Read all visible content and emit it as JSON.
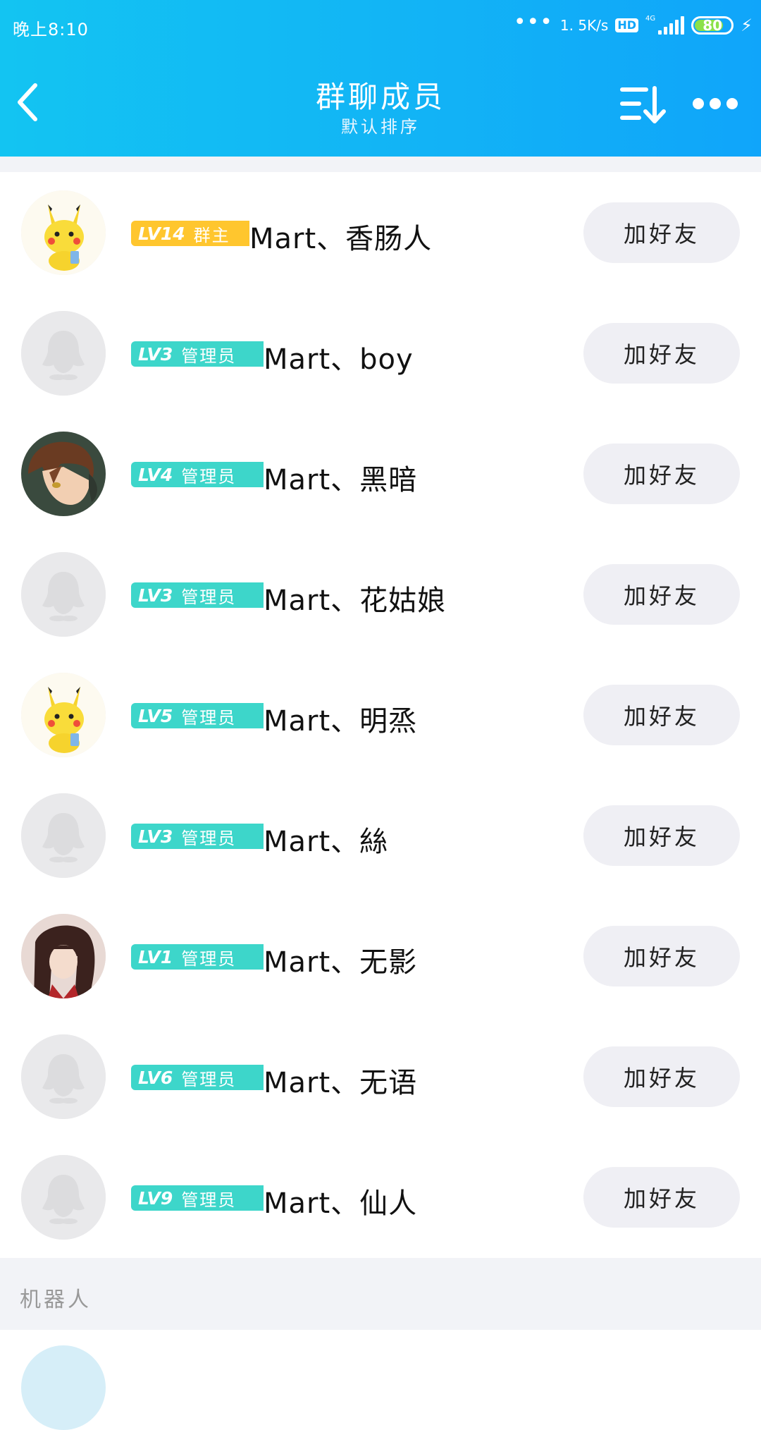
{
  "status_bar": {
    "time": "晚上8:10",
    "net_speed": "1. 5K/s",
    "hd": "HD",
    "net_type": "4G",
    "battery": "80",
    "battery_level_percent": 80
  },
  "nav": {
    "title": "群聊成员",
    "subtitle": "默认排序"
  },
  "members": [
    {
      "level": "LV14",
      "role": "群主",
      "name": "Mart、香肠人",
      "add_label": "加好友",
      "avatar": "pikachu-avatar"
    },
    {
      "level": "LV3",
      "role": "管理员",
      "name": "Mart、boy",
      "add_label": "加好友",
      "avatar": "default-penguin-avatar"
    },
    {
      "level": "LV4",
      "role": "管理员",
      "name": "Mart、黑暗",
      "add_label": "加好友",
      "avatar": "anime-boy-avatar"
    },
    {
      "level": "LV3",
      "role": "管理员",
      "name": "Mart、花姑娘",
      "add_label": "加好友",
      "avatar": "default-penguin-avatar"
    },
    {
      "level": "LV5",
      "role": "管理员",
      "name": "Mart、明烝",
      "add_label": "加好友",
      "avatar": "pikachu-avatar"
    },
    {
      "level": "LV3",
      "role": "管理员",
      "name": "Mart、絲",
      "add_label": "加好友",
      "avatar": "default-penguin-avatar"
    },
    {
      "level": "LV1",
      "role": "管理员",
      "name": "Mart、无影",
      "add_label": "加好友",
      "avatar": "anime-character-avatar"
    },
    {
      "level": "LV6",
      "role": "管理员",
      "name": "Mart、无语",
      "add_label": "加好友",
      "avatar": "default-penguin-avatar"
    },
    {
      "level": "LV9",
      "role": "管理员",
      "name": "Mart、仙人",
      "add_label": "加好友",
      "avatar": "default-penguin-avatar"
    }
  ],
  "robot_section": {
    "label": "机器人"
  },
  "colors": {
    "header_start": "#13c4f2",
    "header_end": "#10a5fa",
    "owner_badge": "#ffc62e",
    "admin_badge": "#3dd6ca",
    "button_bg": "#efeff4"
  }
}
